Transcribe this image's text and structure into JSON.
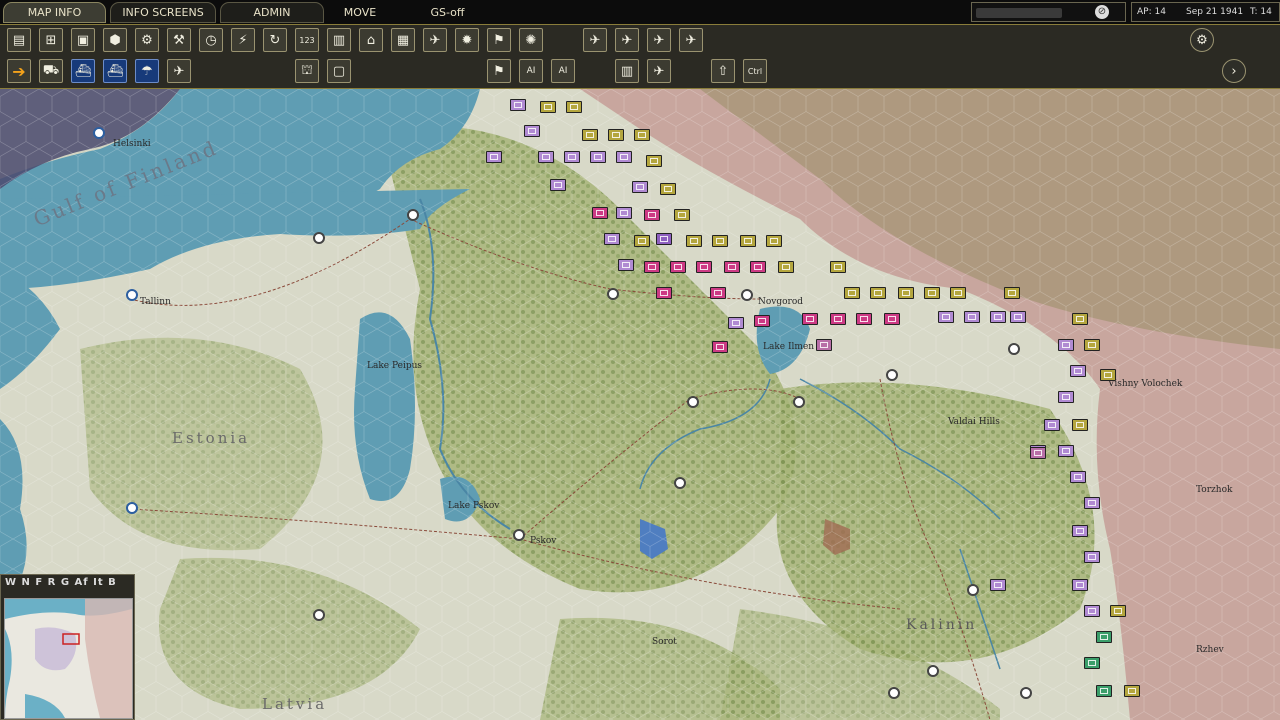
{
  "top_tabs": {
    "map_info": "MAP INFO",
    "info_screens": "INFO SCREENS",
    "admin": "ADMIN",
    "move": "MOVE",
    "gs_off": "GS-off"
  },
  "status": {
    "ap": "AP: 14",
    "date": "Sep 21 1941",
    "turn": "T: 14"
  },
  "toolbar2": {
    "ai_label": "AI",
    "ctrl_label": "Ctrl"
  },
  "map": {
    "cities": {
      "helsinki": "Helsinki",
      "tallinn": "Tallinn",
      "pskov": "Pskov",
      "novgorod": "Novgorod",
      "vishny_volochek": "Vishny Volochek",
      "torzhok": "Torzhok",
      "sorot": "Sorot",
      "rzhev": "Rzhev"
    },
    "regions": {
      "gulf": "Gulf of Finland",
      "estonia": "Estonia",
      "latvia": "Latvia",
      "kalinin": "Kalinin",
      "valdai": "Valdai Hills"
    },
    "lakes": {
      "peipus": "Lake Peipus",
      "pskov": "Lake Pskov",
      "ilmen": "Lake Ilmen"
    },
    "unit_label": "123"
  },
  "minimap": {
    "tabs": "W N F R G Af It B"
  },
  "colors": {
    "sea": "#5f9db3",
    "land": "#dcdccc",
    "forest": "#9fb06c",
    "soviet_territory": "#c7a29a",
    "toolbar_bg": "#2b2a23",
    "gold_border": "#8a7d3a"
  }
}
